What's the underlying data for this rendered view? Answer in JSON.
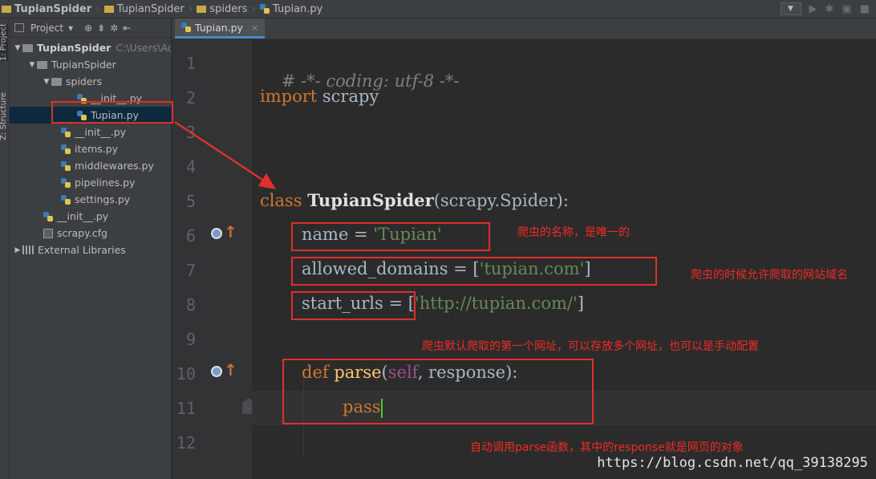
{
  "navbar": {
    "crumbs": [
      "TupianSpider",
      "TupianSpider",
      "spiders",
      "Tupian.py"
    ],
    "run_combo": "▼"
  },
  "left_strip": {
    "project_tab": "1: Project",
    "structure_tab": "Z: Structure"
  },
  "project_panel": {
    "toolbar_label": "Project",
    "tree": [
      {
        "label": "TupianSpider",
        "suffix": "C:\\Users\\Ad",
        "type": "root",
        "expanded": true
      },
      {
        "label": "TupianSpider",
        "type": "dir",
        "expanded": true
      },
      {
        "label": "spiders",
        "type": "dir",
        "expanded": true
      },
      {
        "label": "__init__.py",
        "type": "py"
      },
      {
        "label": "Tupian.py",
        "type": "py",
        "selected": true
      },
      {
        "label": "__init__.py",
        "type": "py"
      },
      {
        "label": "items.py",
        "type": "py"
      },
      {
        "label": "middlewares.py",
        "type": "py"
      },
      {
        "label": "pipelines.py",
        "type": "py"
      },
      {
        "label": "settings.py",
        "type": "py"
      },
      {
        "label": "__init__.py",
        "type": "py"
      },
      {
        "label": "scrapy.cfg",
        "type": "cfg"
      },
      {
        "label": "External Libraries",
        "type": "lib",
        "expanded": false
      }
    ]
  },
  "editor": {
    "tab_label": "Tupian.py",
    "tab_close": "×",
    "line_numbers": [
      "1",
      "2",
      "3",
      "4",
      "5",
      "6",
      "7",
      "8",
      "9",
      "10",
      "11",
      "12"
    ],
    "code": {
      "l1": "# -*- coding: utf-8 -*-",
      "l2_kw": "import",
      "l2_mod": " scrapy",
      "l5_kw": "class ",
      "l5_name": "TupianSpider",
      "l5_base": "(scrapy.Spider):",
      "l6_attr": "name = ",
      "l6_val": "'Tupian'",
      "l7_attr": "allowed_domains = [",
      "l7_val": "'tupian.com'",
      "l7_end": "]",
      "l8_attr": "start_urls = [",
      "l8_val": "'http://tupian.com/'",
      "l8_end": "]",
      "l10_kw": "def ",
      "l10_fn": "parse",
      "l10_open": "(",
      "l10_self": "self",
      "l10_rest": ", response):",
      "l11_kw": "pass"
    }
  },
  "annotations": {
    "name_note": "爬虫的名称，是唯一的",
    "domains_note": "爬虫的时候允许爬取的网站域名",
    "urls_note": "爬虫默认爬取的第一个网址，可以存放多个网址，也可以是手动配置",
    "parse_note": "自动调用parse函数，其中的response就是网页的对象"
  },
  "watermark": "https://blog.csdn.net/qq_39138295",
  "colors": {
    "keyword": "#cc7832",
    "string": "#6a8759",
    "annotation_red": "#e0302a",
    "selection": "#0d293e"
  }
}
